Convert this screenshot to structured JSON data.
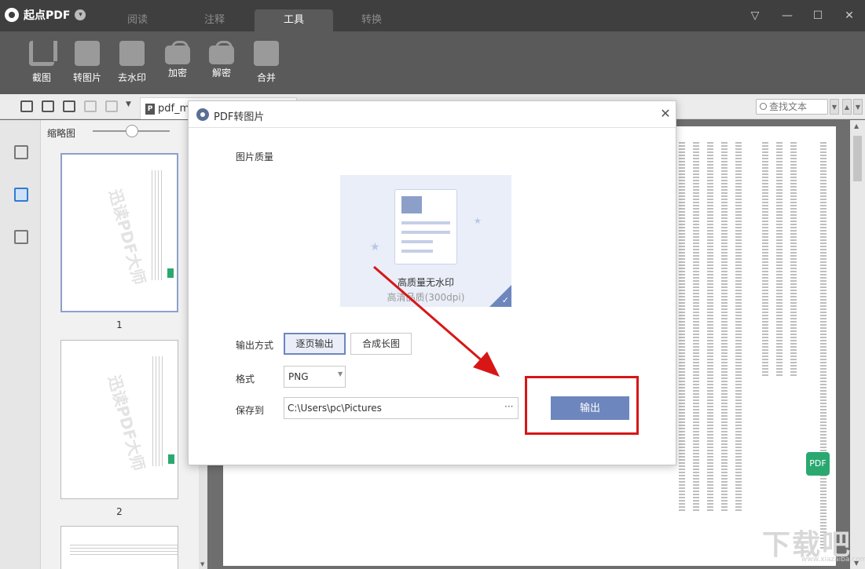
{
  "app": {
    "name": "起点PDF"
  },
  "tabs": [
    {
      "label": "阅读"
    },
    {
      "label": "注释"
    },
    {
      "label": "工具",
      "active": true
    },
    {
      "label": "转换"
    }
  ],
  "toolbar": {
    "tools": [
      {
        "label": "截图",
        "icon": "crop-icon"
      },
      {
        "label": "转图片",
        "icon": "image-convert-icon"
      },
      {
        "label": "去水印",
        "icon": "remove-watermark-icon"
      },
      {
        "label": "加密",
        "icon": "lock-icon"
      },
      {
        "label": "解密",
        "icon": "unlock-icon"
      },
      {
        "label": "合并",
        "icon": "merge-icon"
      }
    ]
  },
  "document": {
    "tab_name": "pdf_me"
  },
  "search": {
    "placeholder": "查找文本"
  },
  "thumbnails": {
    "title": "缩略图",
    "page_numbers": [
      "1",
      "2"
    ],
    "watermark": "迅读PDF大师"
  },
  "dialog": {
    "title": "PDF转图片",
    "quality_label": "图片质量",
    "quality_title": "高质量无水印",
    "quality_sub": "高清品质(300dpi)",
    "output_mode_label": "输出方式",
    "output_modes": [
      "逐页输出",
      "合成长图"
    ],
    "selected_mode": "逐页输出",
    "format_label": "格式",
    "format_value": "PNG",
    "save_label": "保存到",
    "save_path": "C:\\Users\\pc\\Pictures",
    "browse_label": "···",
    "export_label": "输出"
  },
  "page_side": {
    "badge": "PDF"
  },
  "watermark": {
    "text": "下载吧",
    "sub": "www.xiazaiba.com"
  },
  "colors": {
    "titlebar": "#3f3f3f",
    "toolbar": "#5a5a5a",
    "accent": "#6d86bd",
    "annotation": "#d81616",
    "green": "#2aa870"
  }
}
